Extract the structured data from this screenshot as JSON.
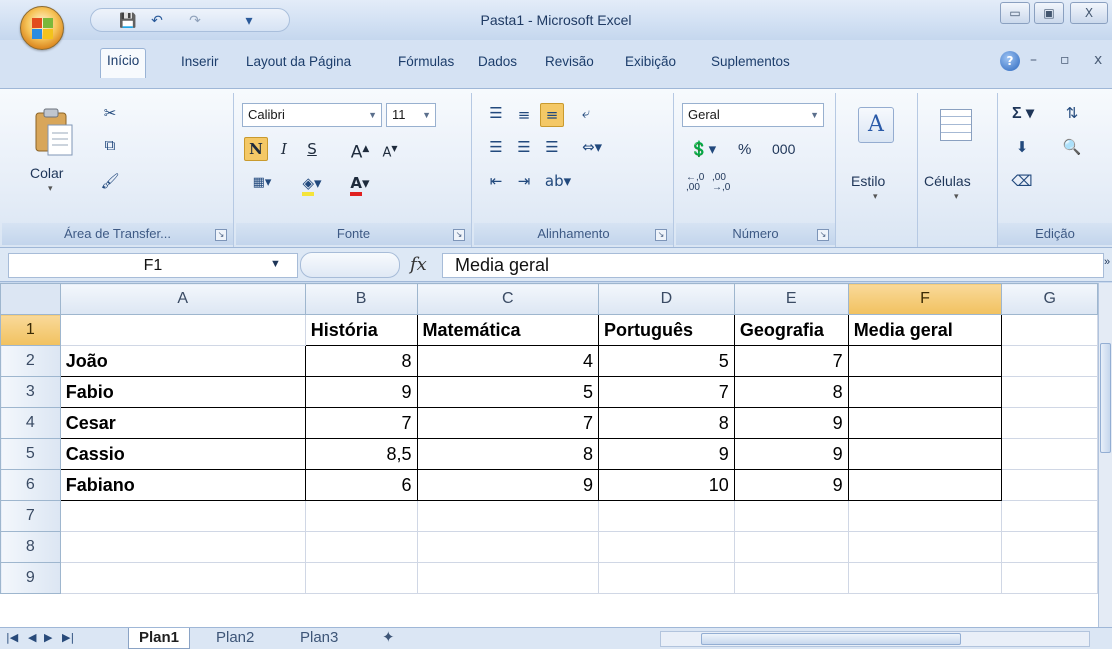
{
  "window": {
    "title": "Pasta1 - Microsoft Excel",
    "minimize": "▭",
    "restore": "▣",
    "close": "X"
  },
  "qat": {
    "save": "💾",
    "undo": "↶",
    "redo": "↷",
    "customize": "▾"
  },
  "tabs": [
    "Início",
    "Inserir",
    "Layout da Página",
    "Fórmulas",
    "Dados",
    "Revisão",
    "Exibição",
    "Suplementos"
  ],
  "ribbon": {
    "clipboard": {
      "label": "Área de Transfer...",
      "paste": "Colar"
    },
    "font": {
      "label": "Fonte",
      "name": "Calibri",
      "size": "11",
      "bold": "N",
      "italic": "I",
      "underline": "S"
    },
    "alignment": {
      "label": "Alinhamento"
    },
    "number": {
      "label": "Número",
      "format": "Geral",
      "percent": "%",
      "thousands": "000"
    },
    "style": {
      "label": "Estilo"
    },
    "cells": {
      "label": "Células"
    },
    "editing": {
      "label": "Edição",
      "sum": "Σ"
    }
  },
  "formula_bar": {
    "cell_ref": "F1",
    "fx": "fx",
    "content": "Media geral"
  },
  "grid": {
    "columns": [
      "A",
      "B",
      "C",
      "D",
      "E",
      "F",
      "G"
    ],
    "rows": [
      "1",
      "2",
      "3",
      "4",
      "5",
      "6",
      "7",
      "8",
      "9"
    ],
    "header_row": [
      "",
      "História",
      "Matemática",
      "Português",
      "Geografia",
      "Media geral"
    ],
    "data": [
      [
        "João",
        "8",
        "4",
        "5",
        "7",
        ""
      ],
      [
        "Fabio",
        "9",
        "5",
        "7",
        "8",
        ""
      ],
      [
        "Cesar",
        "7",
        "7",
        "8",
        "9",
        ""
      ],
      [
        "Cassio",
        "8,5",
        "8",
        "9",
        "9",
        ""
      ],
      [
        "Fabiano",
        "6",
        "9",
        "10",
        "9",
        ""
      ]
    ]
  },
  "sheets": [
    "Plan1",
    "Plan2",
    "Plan3"
  ],
  "colors": {
    "accent": "#1c3d6b",
    "ribbon_bg": "#e7eef8",
    "selected_header": "#f1c15f"
  }
}
